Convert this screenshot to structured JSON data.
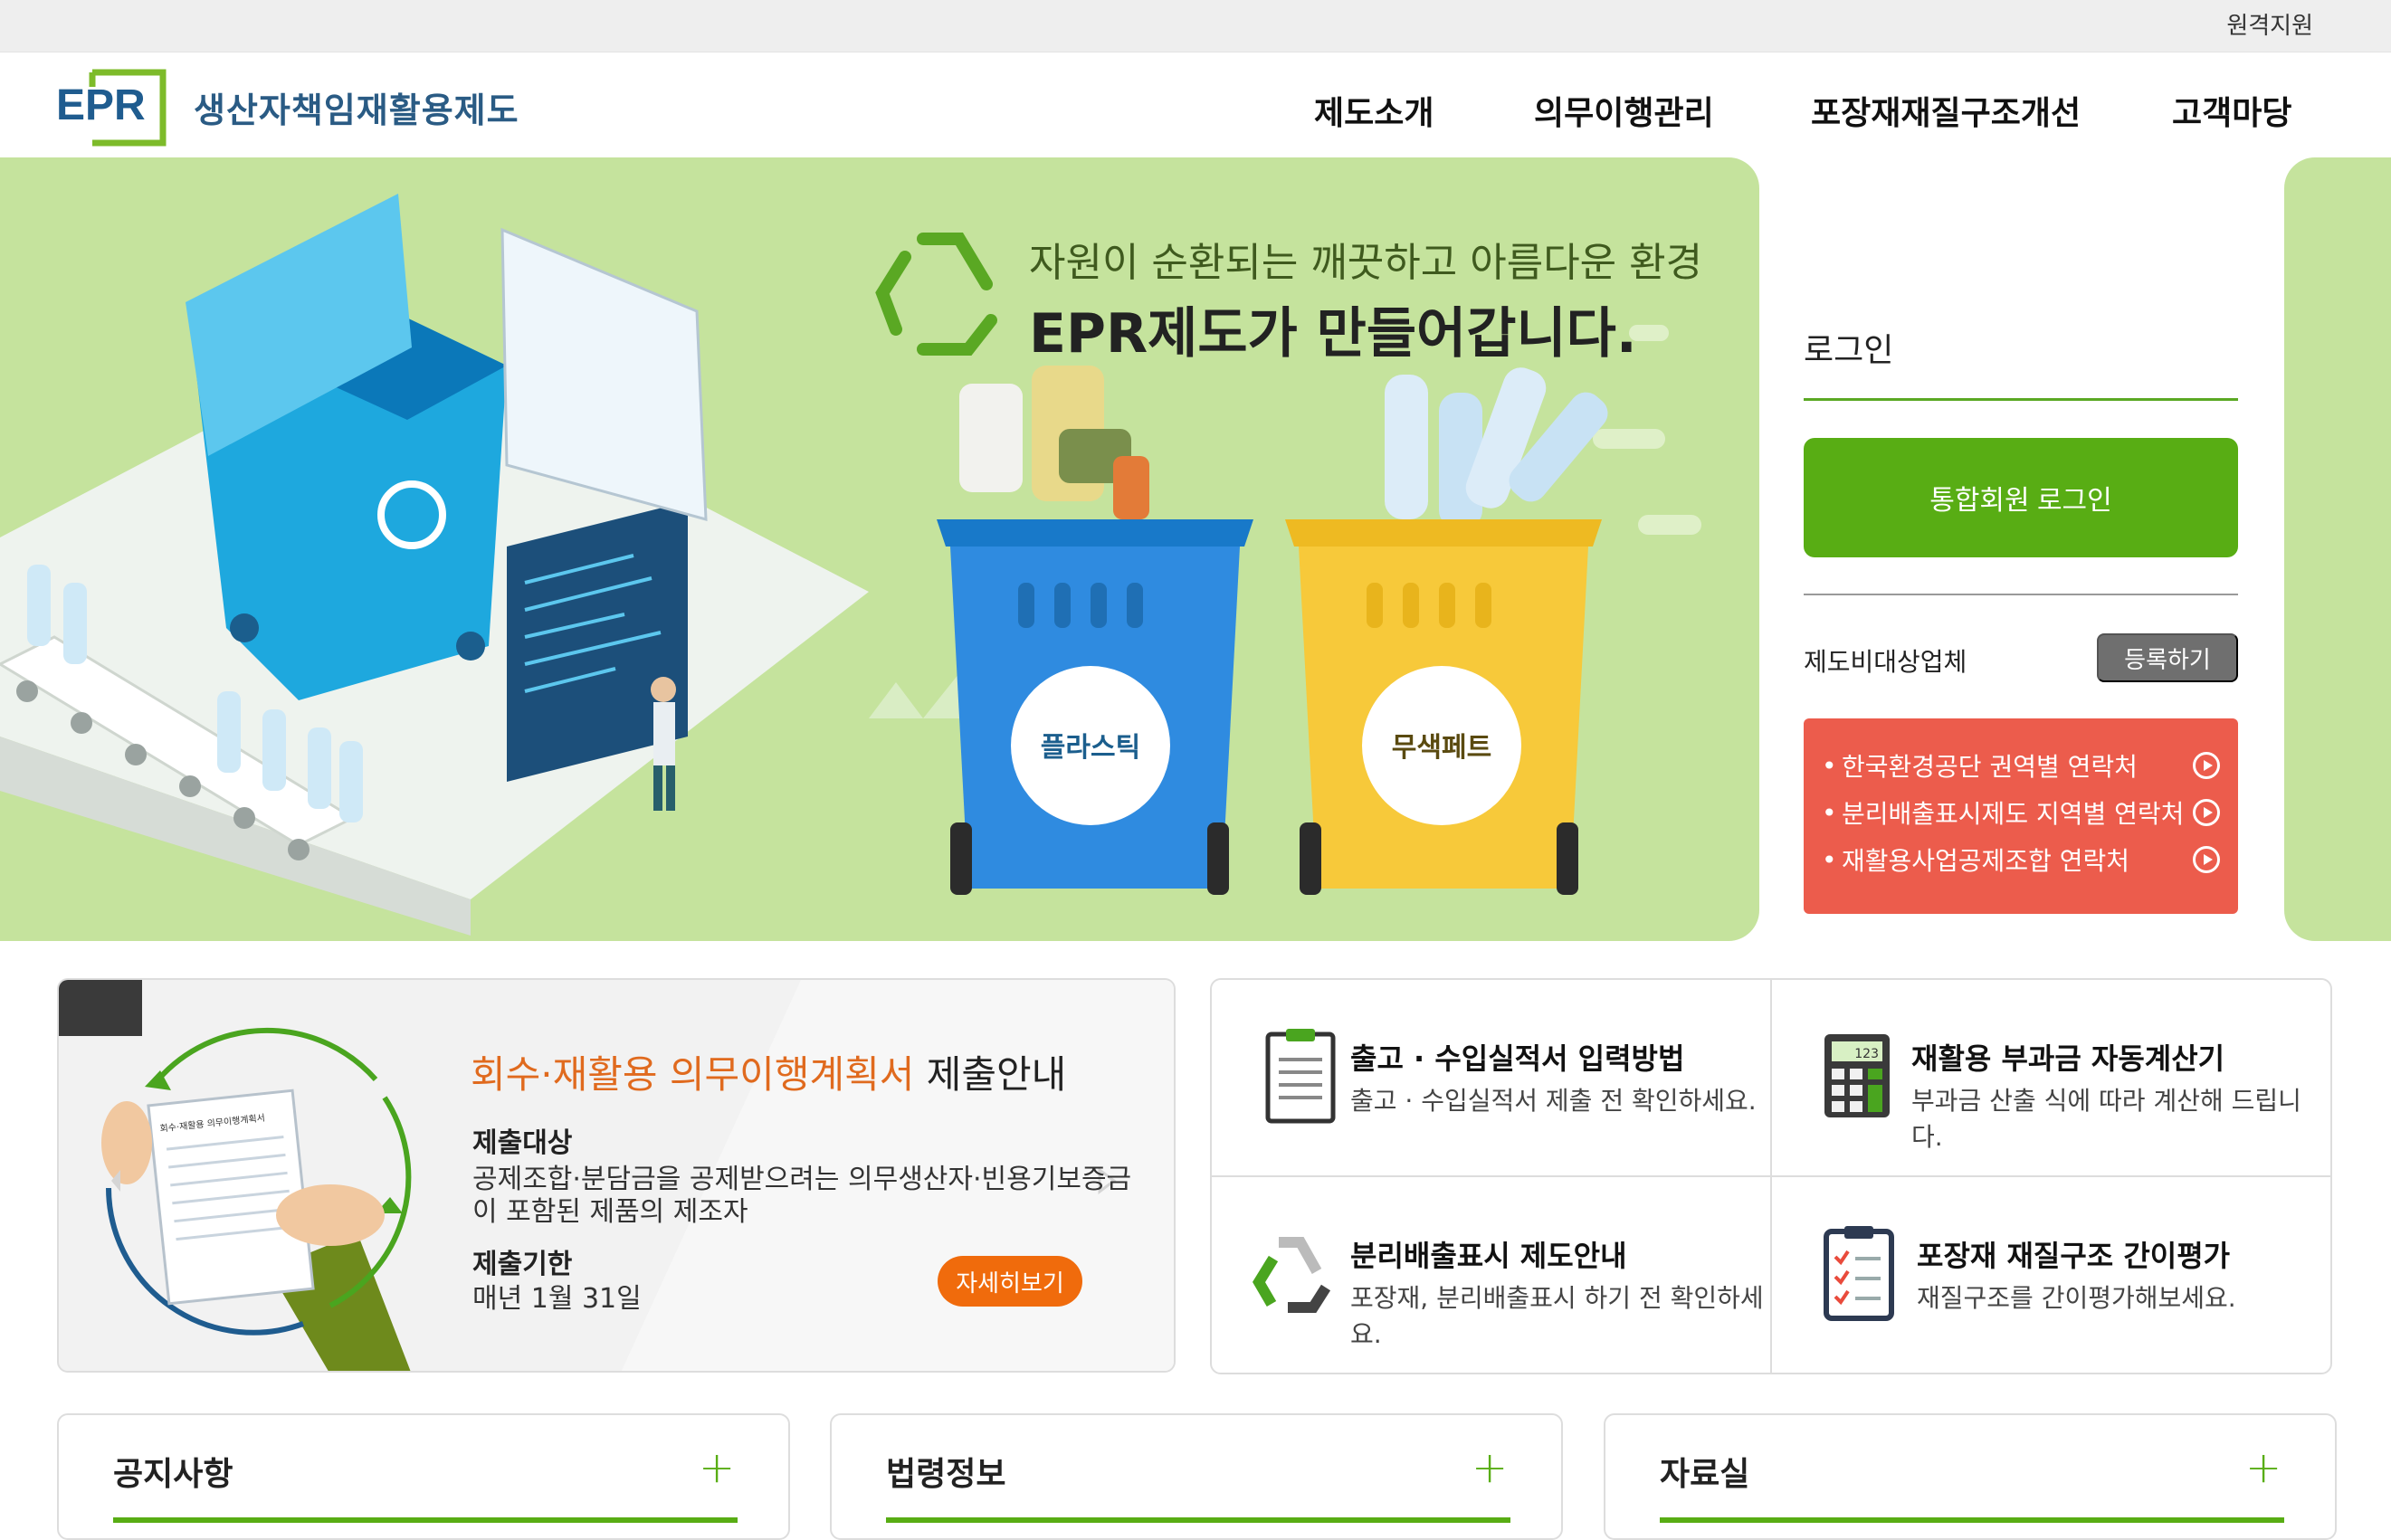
{
  "topbar": {
    "remote_support": "원격지원"
  },
  "header": {
    "logo_mark": "EPR",
    "logo_title": "생산자책임재활용제도",
    "nav": [
      "제도소개",
      "의무이행관리",
      "포장재재질구조개선",
      "고객마당"
    ]
  },
  "hero": {
    "subtitle": "자원이 순환되는 깨끗하고 아름다운 환경",
    "title": "EPR제도가 만들어갑니다.",
    "bin_blue_label": "플라스틱",
    "bin_yellow_label": "무색페트"
  },
  "login": {
    "title": "로그인",
    "integrated_login": "통합회원 로그인",
    "non_member_label": "제도비대상업체",
    "register": "등록하기",
    "contacts": [
      "한국환경공단 권역별 연락처",
      "분리배출표시제도 지역별 연락처",
      "재활용사업공제조합 연락처"
    ]
  },
  "banner": {
    "title_highlight": "회수·재활용 의무이행계획서",
    "title_rest": " 제출안내",
    "target_heading": "제출대상",
    "target_line1": "공제조합·분담금을 공제받으려는 의무생산자·빈용기보증금",
    "target_line2": "이 포함된 제품의 제조자",
    "deadline_heading": "제출기한",
    "deadline_value": "매년 1월 31일",
    "detail_button": "자세히보기",
    "doc_title": "회수·재활용 의무이행계획서"
  },
  "quick": [
    {
      "title": "출고 · 수입실적서 입력방법",
      "desc": "출고 · 수입실적서 제출 전 확인하세요.",
      "icon": "clipboard-icon"
    },
    {
      "title": "재활용 부과금 자동계산기",
      "desc": "부과금 산출 식에 따라 계산해 드립니다.",
      "icon": "calculator-icon",
      "icon_text": "123"
    },
    {
      "title": "분리배출표시 제도안내",
      "desc": "포장재, 분리배출표시 하기 전 확인하세요.",
      "icon": "recycle-icon"
    },
    {
      "title": "포장재 재질구조 간이평가",
      "desc": "재질구조를 간이평가해보세요.",
      "icon": "checklist-icon"
    }
  ],
  "boards": [
    "공지사항",
    "법령정보",
    "자료실"
  ],
  "colors": {
    "brand_green": "#58ad14",
    "hero_bg": "#c5e39d",
    "contact_red": "#ec5c4c",
    "orange": "#f06b0c"
  }
}
